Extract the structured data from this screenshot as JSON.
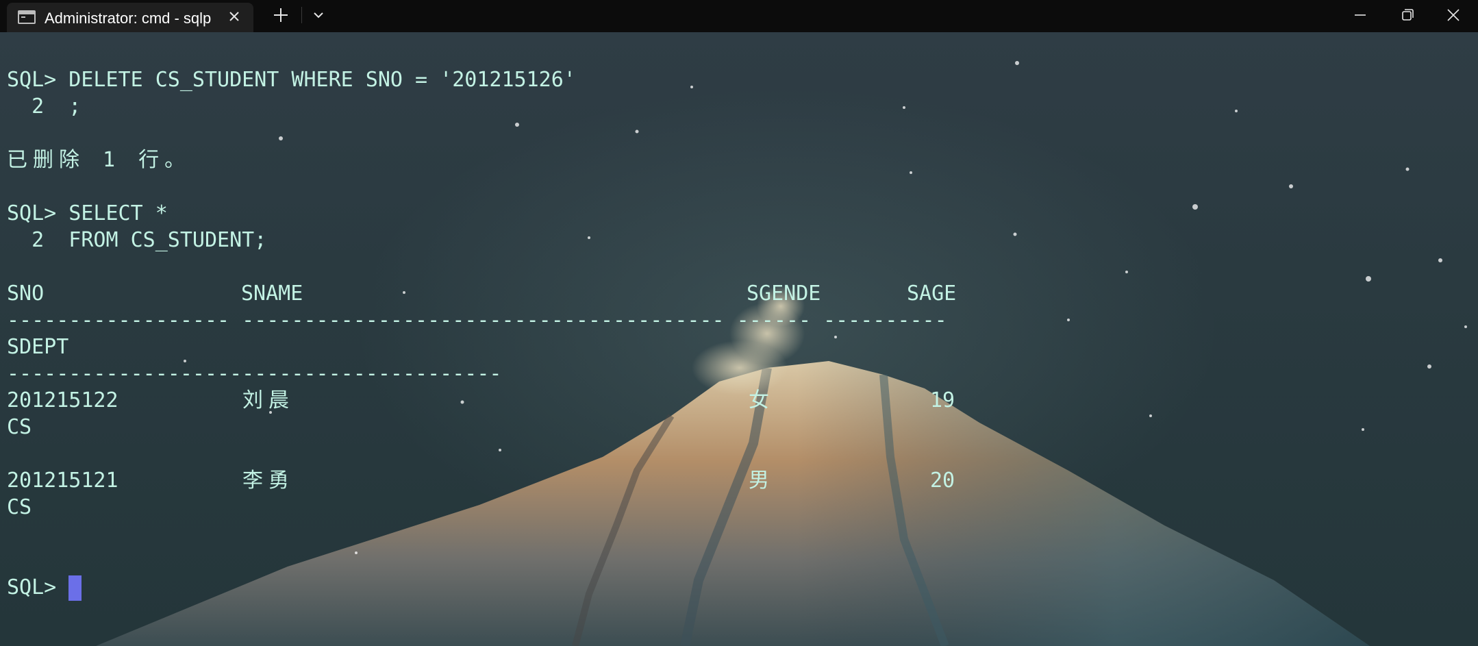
{
  "window": {
    "tab_title": "Administrator: cmd - sqlp",
    "icons": [
      "terminal-icon",
      "close-icon",
      "plus-icon",
      "chevron-down-icon",
      "minimize-icon",
      "maximize-icon",
      "close-icon"
    ]
  },
  "terminal": {
    "delete_cmd": "SQL> DELETE CS_STUDENT WHERE SNO = '201215126'",
    "delete_cont": "  2  ;",
    "delete_result": "已删除 1 行。",
    "select_cmd": "SQL> SELECT *",
    "select_cont": "  2  FROM CS_STUDENT;",
    "header": {
      "sno": "SNO",
      "sname": "SNAME",
      "sgende": "SGENDE",
      "sage": "SAGE",
      "sdept": "SDEPT"
    },
    "underline1": "------------------ --------------------------------------- ------ ----------",
    "underline2": "----------------------------------------",
    "rows": [
      {
        "sno": "201215122",
        "sname": "刘晨",
        "sgende": "女",
        "sage": "19",
        "sdept": "CS"
      },
      {
        "sno": "201215121",
        "sname": "李勇",
        "sgende": "男",
        "sage": "20",
        "sdept": "CS"
      }
    ],
    "prompt": "SQL> "
  },
  "colors": {
    "text": "#c3f2e4",
    "cursor": "#6b6fe8",
    "titlebar": "#0c0c0c",
    "tab": "#1f1f1f"
  }
}
